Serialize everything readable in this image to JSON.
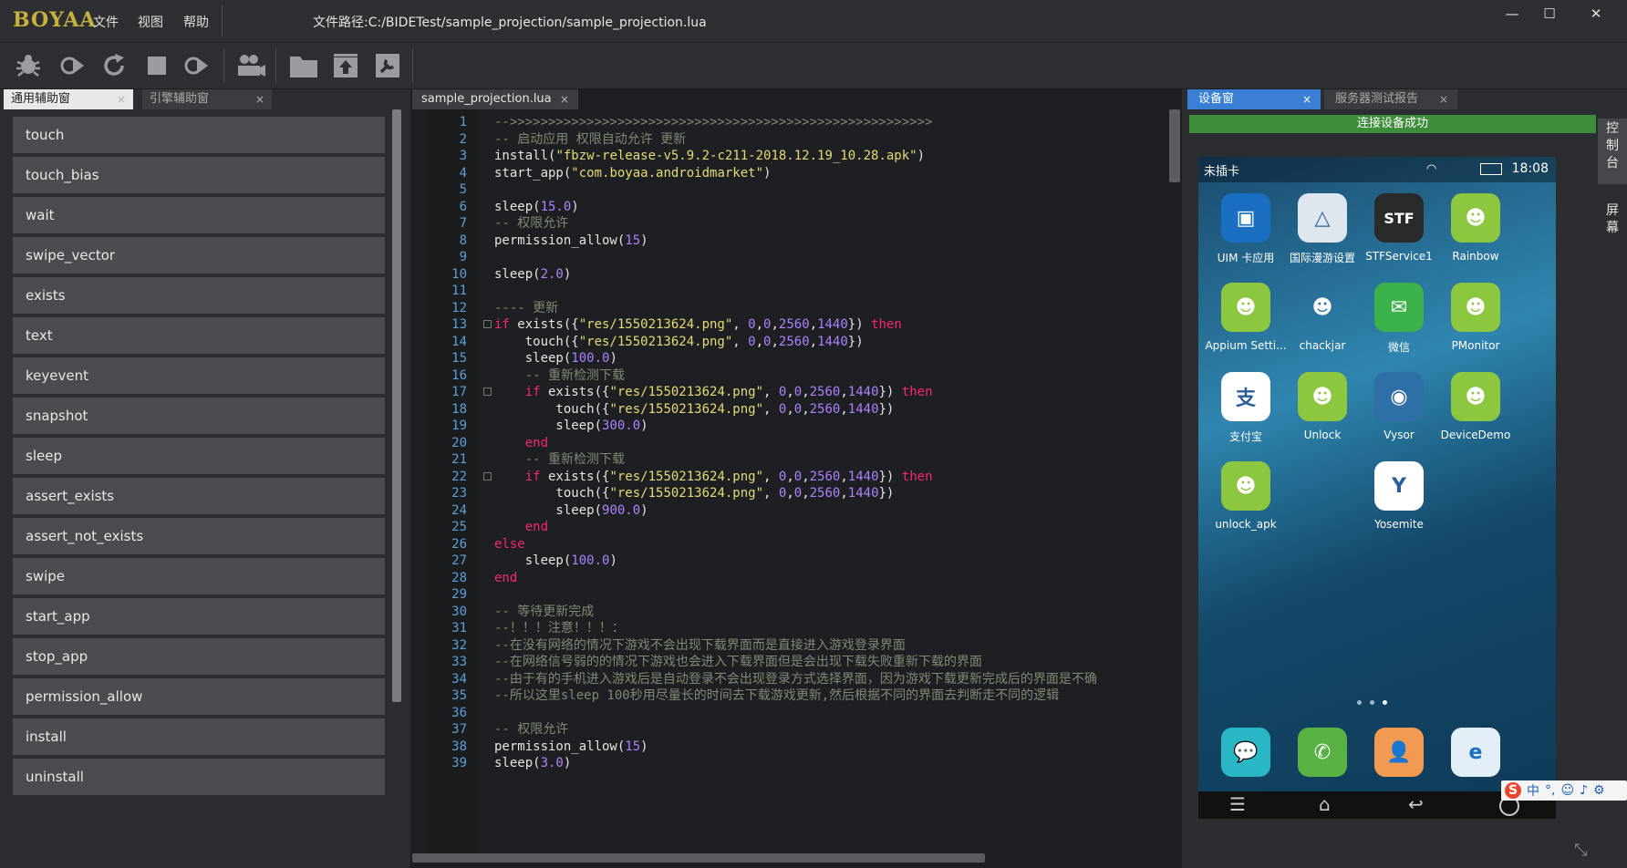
{
  "app": {
    "logo": "BOYAA",
    "menu": [
      "文件",
      "视图",
      "帮助"
    ],
    "file_path": "文件路径:C:/BIDETest/sample_projection/sample_projection.lua",
    "window_controls": {
      "minimize": "—",
      "maximize": "☐",
      "close": "✕"
    }
  },
  "toolbar": {
    "icons": [
      "bug-icon",
      "run-icon",
      "refresh-icon",
      "stop-icon",
      "debug-run-icon",
      "users-icon",
      "folder-icon",
      "upload-icon",
      "settings-tool-icon"
    ]
  },
  "left_panel": {
    "tabs": [
      {
        "label": "通用辅助窗",
        "close": "×",
        "active": true
      },
      {
        "label": "引擎辅助窗",
        "close": "×",
        "active": false
      }
    ],
    "functions": [
      "touch",
      "touch_bias",
      "wait",
      "swipe_vector",
      "exists",
      "text",
      "keyevent",
      "snapshot",
      "sleep",
      "assert_exists",
      "assert_not_exists",
      "swipe",
      "start_app",
      "stop_app",
      "permission_allow",
      "install",
      "uninstall"
    ]
  },
  "editor": {
    "tab": {
      "label": "sample_projection.lua",
      "close": "×"
    },
    "lines": [
      {
        "n": "1",
        "t": "-->>>>>>>>>>>>>>>>>>>>>>>>>>>>>>>>>>>>>>>>>>>>>>>>>>>>>>>"
      },
      {
        "n": "2",
        "t": "-- 启动应用 权限自动允许 更新"
      },
      {
        "n": "3",
        "t": "install(\"fbzw-release-v5.9.2-c211-2018.12.19_10.28.apk\")"
      },
      {
        "n": "4",
        "t": "start_app(\"com.boyaa.androidmarket\")"
      },
      {
        "n": "5",
        "t": ""
      },
      {
        "n": "6",
        "t": "sleep(15.0)"
      },
      {
        "n": "7",
        "t": "-- 权限允许"
      },
      {
        "n": "8",
        "t": "permission_allow(15)"
      },
      {
        "n": "9",
        "t": ""
      },
      {
        "n": "10",
        "t": "sleep(2.0)"
      },
      {
        "n": "11",
        "t": ""
      },
      {
        "n": "12",
        "t": "---- 更新"
      },
      {
        "n": "13",
        "t": "if exists({\"res/1550213624.png\", 0,0,2560,1440}) then"
      },
      {
        "n": "14",
        "t": "    touch({\"res/1550213624.png\", 0,0,2560,1440})"
      },
      {
        "n": "15",
        "t": "    sleep(100.0)"
      },
      {
        "n": "16",
        "t": "    -- 重新检测下载"
      },
      {
        "n": "17",
        "t": "    if exists({\"res/1550213624.png\", 0,0,2560,1440}) then"
      },
      {
        "n": "18",
        "t": "        touch({\"res/1550213624.png\", 0,0,2560,1440})"
      },
      {
        "n": "19",
        "t": "        sleep(300.0)"
      },
      {
        "n": "20",
        "t": "    end"
      },
      {
        "n": "21",
        "t": "    -- 重新检测下载"
      },
      {
        "n": "22",
        "t": "    if exists({\"res/1550213624.png\", 0,0,2560,1440}) then"
      },
      {
        "n": "23",
        "t": "        touch({\"res/1550213624.png\", 0,0,2560,1440})"
      },
      {
        "n": "24",
        "t": "        sleep(900.0)"
      },
      {
        "n": "25",
        "t": "    end"
      },
      {
        "n": "26",
        "t": "else"
      },
      {
        "n": "27",
        "t": "    sleep(100.0)"
      },
      {
        "n": "28",
        "t": "end"
      },
      {
        "n": "29",
        "t": ""
      },
      {
        "n": "30",
        "t": "-- 等待更新完成"
      },
      {
        "n": "31",
        "t": "--！！！注意！！！："
      },
      {
        "n": "32",
        "t": "--在没有网络的情况下游戏不会出现下载界面而是直接进入游戏登录界面"
      },
      {
        "n": "33",
        "t": "--在网络信号弱的的情况下游戏也会进入下载界面但是会出现下载失败重新下载的界面"
      },
      {
        "n": "34",
        "t": "--由于有的手机进入游戏后是自动登录不会出现登录方式选择界面，因为游戏下载更新完成后的界面是不确"
      },
      {
        "n": "35",
        "t": "--所以这里sleep 100秒用尽量长的时间去下载游戏更新,然后根据不同的界面去判断走不同的逻辑"
      },
      {
        "n": "36",
        "t": ""
      },
      {
        "n": "37",
        "t": "-- 权限允许"
      },
      {
        "n": "38",
        "t": "permission_allow(15)"
      },
      {
        "n": "39",
        "t": "sleep(3.0)"
      }
    ],
    "fold_lines": [
      13,
      17,
      22
    ]
  },
  "right_panel": {
    "tabs": [
      {
        "label": "设备窗",
        "close": "×",
        "active": true
      },
      {
        "label": "服务器测试报告",
        "close": "×",
        "active": false
      }
    ],
    "connection_status": "连接设备成功",
    "side_tabs": [
      "控制台",
      "屏幕"
    ]
  },
  "device": {
    "carrier": "未插卡",
    "time": "18:08",
    "apps": [
      {
        "label": "UIM 卡应用",
        "color": "#1a6fc2",
        "glyph": "▣"
      },
      {
        "label": "国际漫游设置",
        "color": "#dfe6ee",
        "glyph": "△"
      },
      {
        "label": "STFService1",
        "color": "#2a2a2a",
        "glyph": "STF"
      },
      {
        "label": "Rainbow",
        "color": "#8dc63f",
        "glyph": "☻"
      },
      {
        "label": "Appium Setti...",
        "color": "#8dc63f",
        "glyph": "☻"
      },
      {
        "label": "chackjar",
        "color": "transparent",
        "glyph": "☻"
      },
      {
        "label": "微信",
        "color": "#3bb34a",
        "glyph": "✉"
      },
      {
        "label": "PMonitor",
        "color": "#8dc63f",
        "glyph": "☻"
      },
      {
        "label": "支付宝",
        "color": "#ffffff",
        "glyph": "支"
      },
      {
        "label": "Unlock",
        "color": "#8dc63f",
        "glyph": "☻"
      },
      {
        "label": "Vysor",
        "color": "#2f6fa8",
        "glyph": "◉"
      },
      {
        "label": "DeviceDemo",
        "color": "#8dc63f",
        "glyph": "☻"
      },
      {
        "label": "unlock_apk",
        "color": "#8dc63f",
        "glyph": "☻"
      },
      {
        "label": "Yosemite",
        "color": "#ffffff",
        "glyph": "Y"
      }
    ],
    "dock": [
      {
        "color": "#29b6c5",
        "glyph": "💬"
      },
      {
        "color": "#5ab243",
        "glyph": "✆"
      },
      {
        "color": "#f29a52",
        "glyph": "👤"
      },
      {
        "color": "#e4eef6",
        "glyph": "e"
      }
    ],
    "nav": [
      "☰",
      "⌂",
      "↩"
    ]
  },
  "ime": {
    "logo": "S",
    "items": [
      "中",
      "°,",
      "☺",
      "♪",
      "⚙"
    ]
  }
}
